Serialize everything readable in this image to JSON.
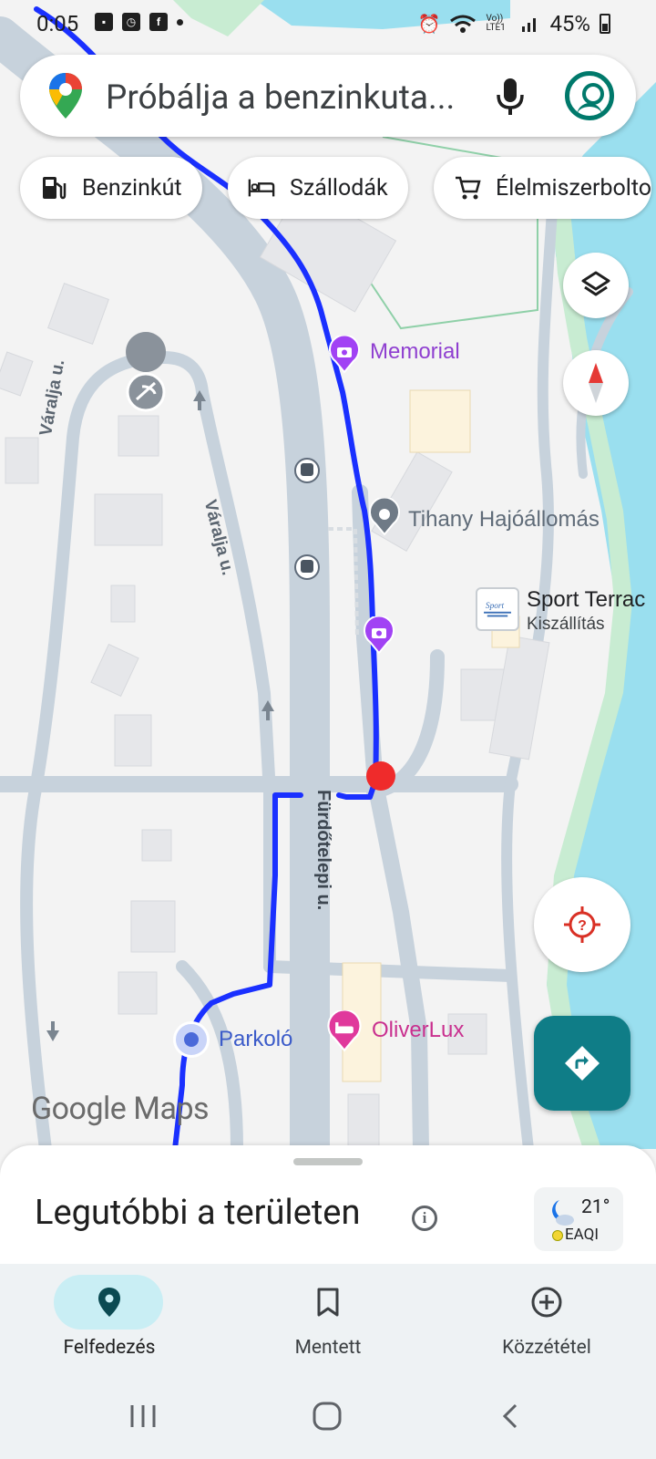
{
  "status_bar": {
    "time": "0:05",
    "battery": "45%",
    "network": "Vo)) LTE1"
  },
  "search": {
    "placeholder": "Próbálja a benzinkuta..."
  },
  "chips": [
    {
      "label": "Benzinkút",
      "icon": "gas-station-icon"
    },
    {
      "label": "Szállodák",
      "icon": "hotel-bed-icon"
    },
    {
      "label": "Élelmiszerbolto",
      "icon": "shopping-cart-icon"
    }
  ],
  "map": {
    "places": {
      "memorial": "Memorial",
      "hajoallomas": "Tihany Hajóállomás",
      "sport_terrace": "Sport Terrac",
      "sport_terrace_sub": "Kiszállítás",
      "parkolo": "Parkoló",
      "oliverlux": "OliverLux"
    },
    "streets": {
      "varalja_1": "Váralja u.",
      "varalja_2": "Váralja u.",
      "furdotelepi": "Fürdőtelepi u."
    },
    "logo": "Google Maps"
  },
  "bottom_sheet": {
    "title": "Legutóbbi a területen",
    "weather_temp": "21°",
    "weather_aqi": "EAQI"
  },
  "nav": {
    "items": [
      {
        "label": "Felfedezés",
        "icon": "explore-pin-icon",
        "active": true
      },
      {
        "label": "Mentett",
        "icon": "bookmark-icon",
        "active": false
      },
      {
        "label": "Közzététel",
        "icon": "add-circle-icon",
        "active": false
      }
    ]
  },
  "colors": {
    "route": "#1a30ff",
    "water": "#9adfef",
    "park_green": "#bfe8c8",
    "road": "#c7d2dc",
    "accent_teal": "#0f7d87",
    "poi_purple": "#a142f4",
    "poi_pink": "#d63ba0"
  }
}
